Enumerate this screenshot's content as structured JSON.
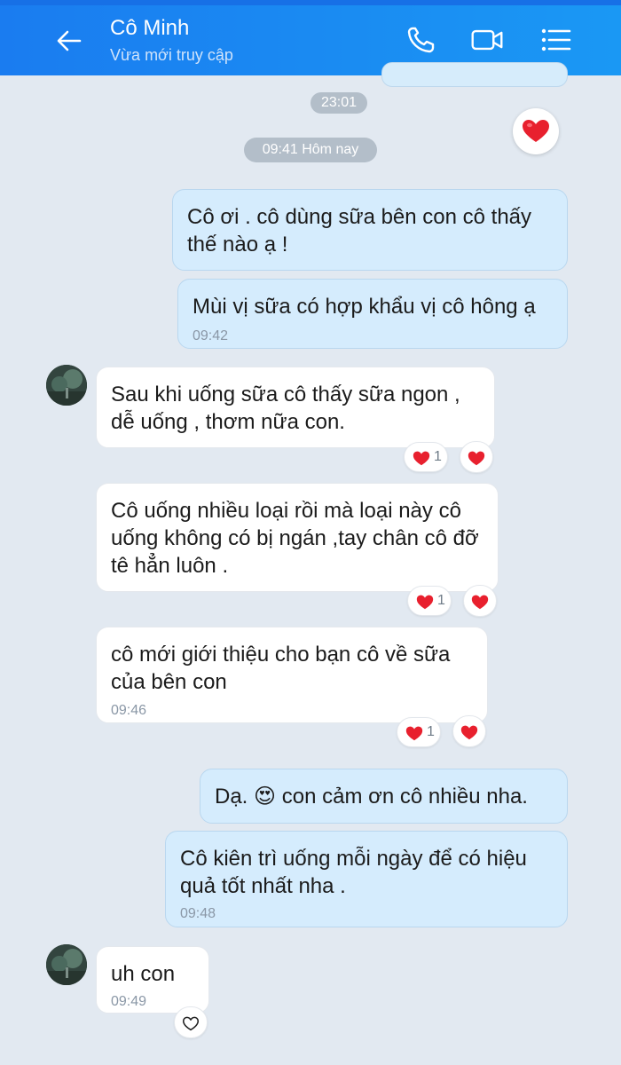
{
  "header": {
    "title": "Cô Minh",
    "subtitle": "Vừa mới truy cập",
    "icons": [
      "back-arrow-icon",
      "phone-icon",
      "video-call-icon",
      "menu-list-icon"
    ]
  },
  "timestamps": {
    "prev": "23:01",
    "today": "09:41 Hôm nay"
  },
  "messages": [
    {
      "sender": "me",
      "text": "Cô ơi . cô dùng sữa bên con cô thấy thế nào ạ !"
    },
    {
      "sender": "me",
      "text": "Mùi vị sữa có hợp khẩu vị cô hông ạ",
      "time": "09:42"
    },
    {
      "sender": "them",
      "text": "Sau khi uống sữa cô thấy sữa ngon , dễ uống , thơm nữa con.",
      "reaction_count": "1"
    },
    {
      "sender": "them",
      "text": "Cô uống nhiều loại rồi mà loại này cô uống không có bị ngán ,tay chân cô đỡ tê hẳn luôn .",
      "reaction_count": "1"
    },
    {
      "sender": "them",
      "text": "cô mới giới thiệu cho bạn cô về sữa của bên con",
      "time": "09:46",
      "reaction_count": "1"
    },
    {
      "sender": "me",
      "text_before": "Dạ.",
      "emoji": "😍",
      "text_after": "con cảm ơn cô nhiều nha."
    },
    {
      "sender": "me",
      "text": "Cô kiên trì uống mỗi ngày để có hiệu quả tốt nhất nha .",
      "time": "09:48"
    },
    {
      "sender": "them",
      "text": "uh con",
      "time": "09:49"
    }
  ],
  "colors": {
    "header": "#1a8cf2",
    "background": "#e2e9f1",
    "my_bubble": "#d5ecfd",
    "their_bubble": "#ffffff",
    "heart": "#e8202e"
  }
}
